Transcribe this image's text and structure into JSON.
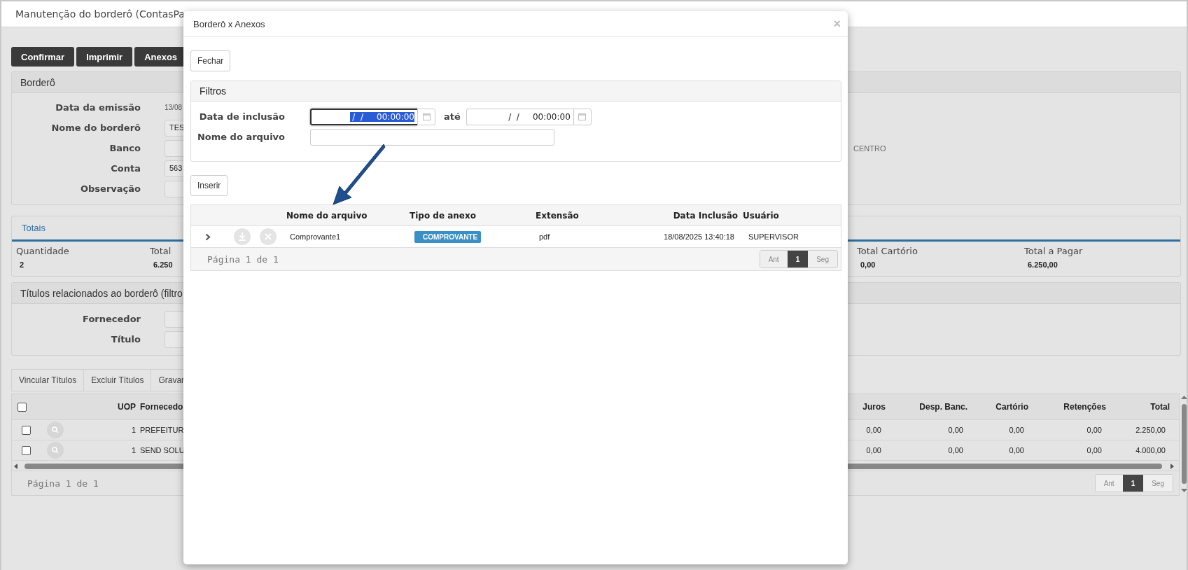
{
  "page": {
    "title": "Manutenção do borderô (ContasPa",
    "actions": [
      "Confirmar",
      "Imprimir",
      "Anexos"
    ]
  },
  "bordero": {
    "title": "Borderô",
    "fields": [
      {
        "label": "Data da emissão",
        "kind": "text",
        "value": "13/08"
      },
      {
        "label": "Nome do borderô",
        "kind": "input",
        "value": "TES"
      },
      {
        "label": "Banco",
        "kind": "input",
        "side_text": "CENTRO"
      },
      {
        "label": "Conta",
        "kind": "input",
        "value": "563"
      },
      {
        "label": "Observação",
        "kind": "input"
      }
    ]
  },
  "totals": {
    "title": "Totais",
    "items": [
      {
        "label": "Quantidade",
        "value": "2"
      },
      {
        "label": "Total",
        "value": "6.250"
      },
      {
        "label": "Total Cartório",
        "value": "0,00"
      },
      {
        "label": "Total a Pagar",
        "value": "6.250,00"
      }
    ]
  },
  "titles_filter": {
    "title": "Títulos relacionados ao borderô (filtro",
    "fields": [
      "Fornecedor",
      "Título"
    ]
  },
  "toolbar_buttons": [
    "Vincular Títulos",
    "Excluir Títulos",
    "Gravar"
  ],
  "table": {
    "all_checked": false,
    "left_columns": [
      "UOP",
      "Fornecedo"
    ],
    "right_columns": [
      "Juros",
      "Desp. Banc.",
      "Cartório",
      "Retenções",
      "Total"
    ],
    "rows": [
      {
        "checked": false,
        "uop": "1",
        "supplier": "PREFEITUR",
        "amounts": [
          "0,00",
          "0,00",
          "0,00",
          "0,00",
          "2.250,00"
        ]
      },
      {
        "checked": false,
        "uop": "1",
        "supplier": "SEND SOLU",
        "amounts": [
          "0,00",
          "0,00",
          "0,00",
          "0,00",
          "4.000,00"
        ]
      }
    ],
    "footer": "Página 1 de 1",
    "pager": [
      {
        "label": "Ant",
        "selected": false
      },
      {
        "label": "1",
        "selected": true
      },
      {
        "label": "Seg",
        "selected": false
      }
    ]
  },
  "dialog": {
    "title": "Borderô x Anexos",
    "close": "×",
    "close_button": "Fechar",
    "filters": {
      "title": "Filtros",
      "date_label": "Data de inclusão",
      "date_from": {
        "value": " /  /     00:00:00",
        "focused": true
      },
      "separator": "até",
      "date_to": {
        "value": " /  /     00:00:00",
        "focused": false
      },
      "name_label": "Nome do arquivo"
    },
    "insert_button": "Inserir",
    "table": {
      "columns": [
        "Nome do arquivo",
        "Tipo de anexo",
        "Extensão",
        "Data Inclusão",
        "Usuário"
      ],
      "rows": [
        {
          "expanded": false,
          "name": "Comprovante1",
          "type": "COMPROVANTE",
          "extension": "pdf",
          "date": "18/08/2025 13:40:18",
          "user": "SUPERVISOR"
        }
      ],
      "footer": "Página 1 de 1",
      "pager": [
        {
          "label": "Ant",
          "selected": false
        },
        {
          "label": "1",
          "selected": true
        },
        {
          "label": "Seg",
          "selected": false
        }
      ]
    }
  }
}
